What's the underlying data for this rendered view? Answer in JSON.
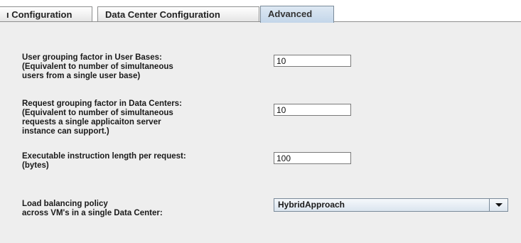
{
  "tabs": [
    {
      "label": "ı Configuration",
      "active": false
    },
    {
      "label": "Data Center Configuration",
      "active": false
    },
    {
      "label": "Advanced",
      "active": true
    }
  ],
  "settings": {
    "user_grouping": {
      "label_lines": [
        "User grouping factor in User Bases:",
        "(Equivalent to number of simultaneous",
        "users from a single user base)"
      ],
      "value": "10"
    },
    "request_grouping": {
      "label_lines": [
        "Request grouping factor in Data Centers:",
        "(Equivalent to number of simultaneous",
        "requests a single applicaiton server",
        "instance can support.)"
      ],
      "value": "10"
    },
    "instruction_length": {
      "label_lines": [
        "Executable instruction length per request:",
        "(bytes)"
      ],
      "value": "100"
    },
    "load_balancing": {
      "label_lines": [
        "Load balancing policy",
        "across VM's in a single Data Center:"
      ],
      "selected": "HybridApproach"
    }
  },
  "colors": {
    "panel_bg": "#eeeeee",
    "active_tab": "#c9d9ea",
    "border": "#8e8f8f"
  }
}
